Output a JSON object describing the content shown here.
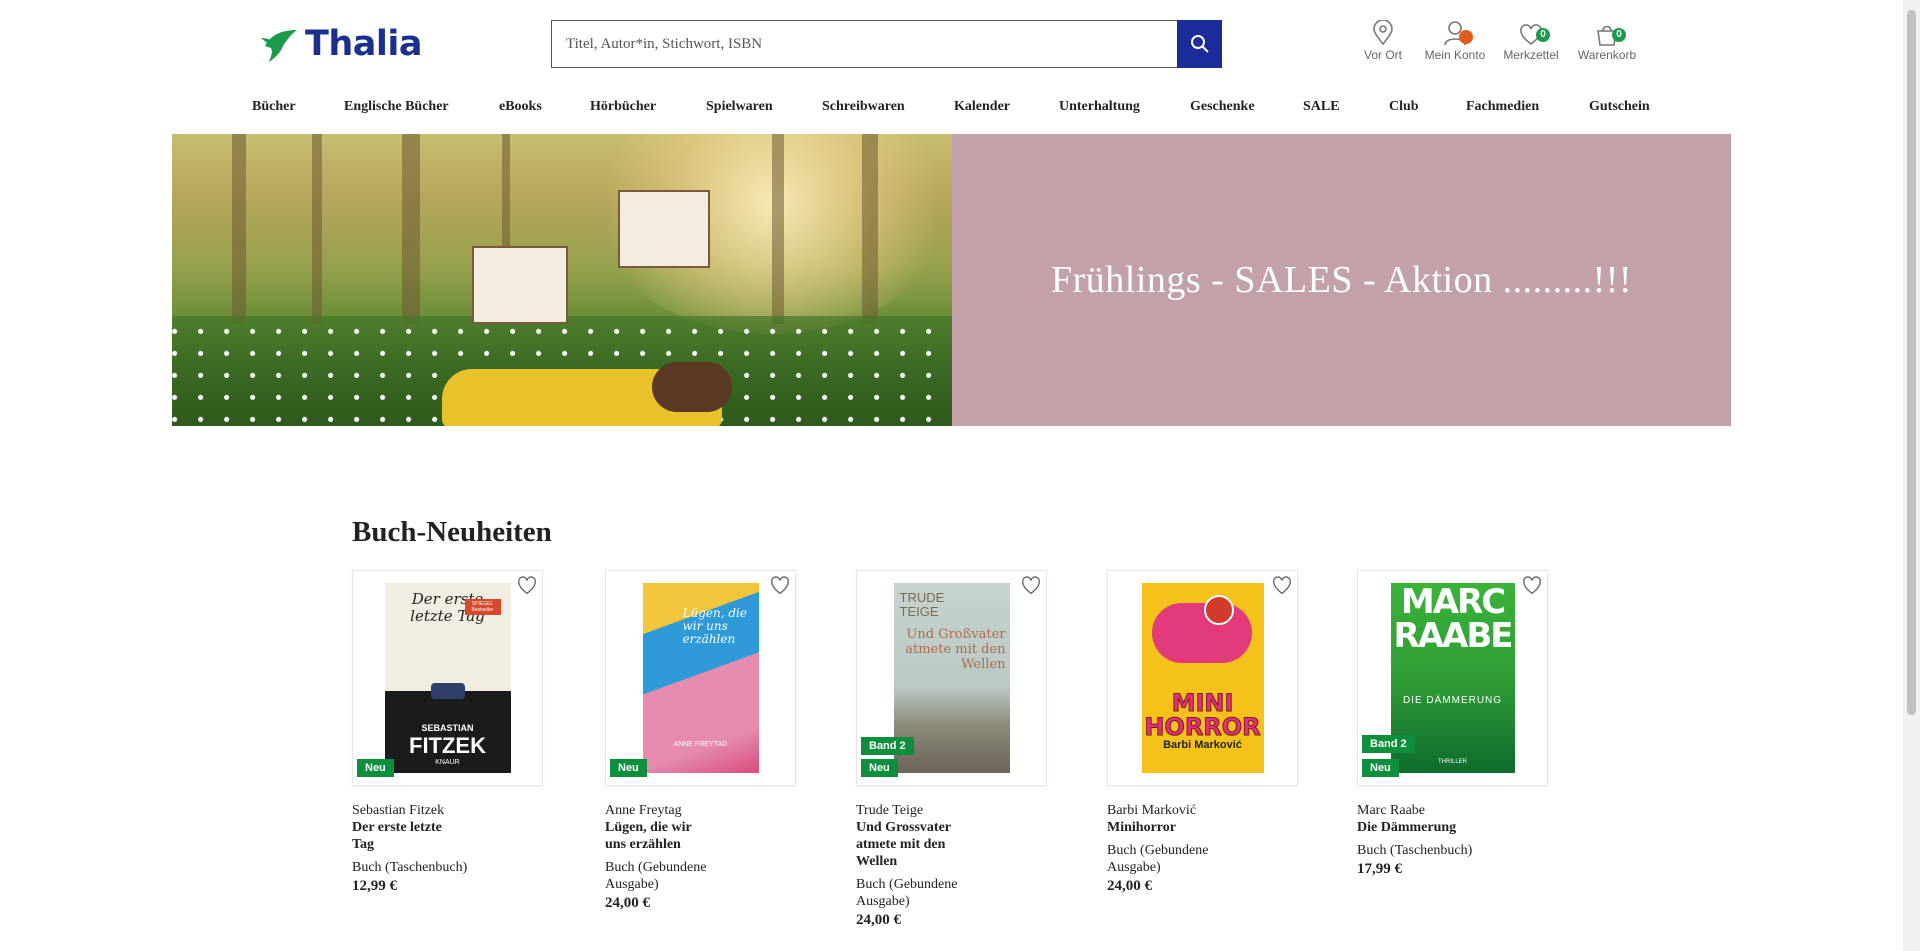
{
  "header": {
    "logo_text": "Thalia",
    "search_placeholder": "Titel, Autor*in, Stichwort, ISBN",
    "icons": [
      {
        "name": "location-icon",
        "label": "Vor Ort"
      },
      {
        "name": "account-icon",
        "label": "Mein Konto"
      },
      {
        "name": "wishlist-icon",
        "label": "Merkzettel",
        "count": "0"
      },
      {
        "name": "cart-icon",
        "label": "Warenkorb",
        "count": "0"
      }
    ]
  },
  "nav": [
    "Bücher",
    "Englische Bücher",
    "eBooks",
    "Hörbücher",
    "Spielwaren",
    "Schreibwaren",
    "Kalender",
    "Unterhaltung",
    "Geschenke",
    "SALE",
    "Club",
    "Fachmedien",
    "Gutschein"
  ],
  "banner": {
    "headline": "Frühlings - SALES - Aktion .........!!!"
  },
  "section": {
    "title": "Buch-Neuheiten"
  },
  "products": [
    {
      "author": "Sebastian Fitzek",
      "title": "Der erste letzte Tag",
      "format": "Buch (Taschenbuch)",
      "price": "12,99 €",
      "tags": [
        "Neu"
      ],
      "cover": {
        "line1": "Der erste letzte Tag",
        "line2": "SEBASTIAN",
        "line3": "FITZEK",
        "publisher": "KNAUR",
        "sticker": "SPIEGEL Bestseller"
      }
    },
    {
      "author": "Anne Freytag",
      "title": "Lügen, die wir uns erzählen",
      "format": "Buch (Gebundene Ausgabe)",
      "price": "24,00 €",
      "tags": [
        "Neu"
      ],
      "cover": {
        "line1": "Lügen, die wir uns erzählen",
        "line2": "ANNE FREYTAG"
      }
    },
    {
      "author": "Trude Teige",
      "title": "Und Grossvater atmete mit den Wellen",
      "format": "Buch (Gebundene Ausgabe)",
      "price": "24,00 €",
      "tags": [
        "Band 2",
        "Neu"
      ],
      "cover": {
        "line1": "TRUDE TEIGE",
        "line2": "Und Großvater atmete mit den Wellen"
      }
    },
    {
      "author": "Barbi Marković",
      "title": "Minihorror",
      "format": "Buch (Gebundene Ausgabe)",
      "price": "24,00 €",
      "tags": [],
      "cover": {
        "line1": "MINI HORROR",
        "line2": "Barbi Marković"
      }
    },
    {
      "author": "Marc Raabe",
      "title": "Die Dämmerung",
      "format": "Buch (Taschenbuch)",
      "price": "17,99 €",
      "tags": [
        "Band 2",
        "Neu"
      ],
      "cover": {
        "line1": "MARC",
        "line2": "RAABE",
        "line3": "DIE DÄMMERUNG",
        "line4": "THRILLER"
      }
    }
  ],
  "colors": {
    "brand_blue": "#1b2b9a",
    "brand_green": "#1a9a4b",
    "tag_green": "#0d8f3e",
    "banner_panel": "#c2a2a8",
    "account_dot": "#e45a1a"
  }
}
